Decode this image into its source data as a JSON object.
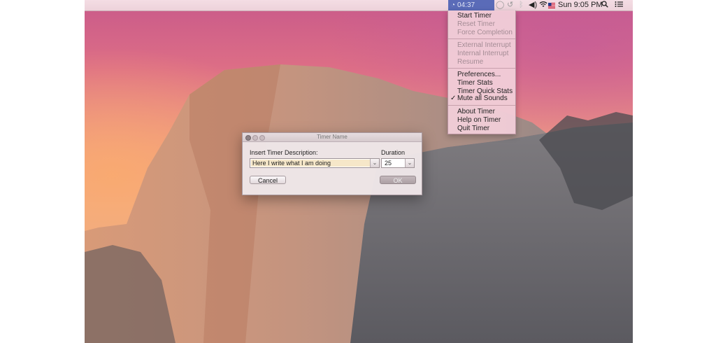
{
  "menubar": {
    "timer_status": "04:37",
    "clock": "Sun 9:05 PM"
  },
  "timer_menu": {
    "items": [
      {
        "label": "Start Timer",
        "enabled": true
      },
      {
        "label": "Reset Timer",
        "enabled": false
      },
      {
        "label": "Force Completion",
        "enabled": false
      },
      {
        "label": "External Interrupt",
        "enabled": false
      },
      {
        "label": "Internal Interrupt",
        "enabled": false
      },
      {
        "label": "Resume",
        "enabled": false
      },
      {
        "label": "Preferences...",
        "enabled": true
      },
      {
        "label": "Timer Stats",
        "enabled": true
      },
      {
        "label": "Timer Quick Stats",
        "enabled": true
      },
      {
        "label": "Mute all Sounds",
        "enabled": true,
        "checked": true
      },
      {
        "label": "About Timer",
        "enabled": true
      },
      {
        "label": "Help on Timer",
        "enabled": true
      },
      {
        "label": "Quit Timer",
        "enabled": true
      }
    ],
    "check_glyph": "✓"
  },
  "dialog": {
    "title": "Timer Name",
    "description_label": "Insert Timer Description:",
    "description_value": "Here I write what I am doing",
    "duration_label": "Duration",
    "duration_value": "25",
    "cancel_label": "Cancel",
    "ok_label": "OK"
  },
  "icons": {
    "timer": "timer-icon",
    "chat": "chat-bubble-icon",
    "history": "time-machine-icon",
    "bluetooth": "bluetooth-icon",
    "volume": "volume-icon",
    "wifi": "wifi-icon",
    "flag": "us-flag-icon",
    "search": "search-icon",
    "list": "notification-list-icon"
  },
  "colors": {
    "timer_status_bg": "#5a6bb8",
    "menu_bg": "#f0cdd7",
    "input_highlight": "#f6e7c9"
  }
}
